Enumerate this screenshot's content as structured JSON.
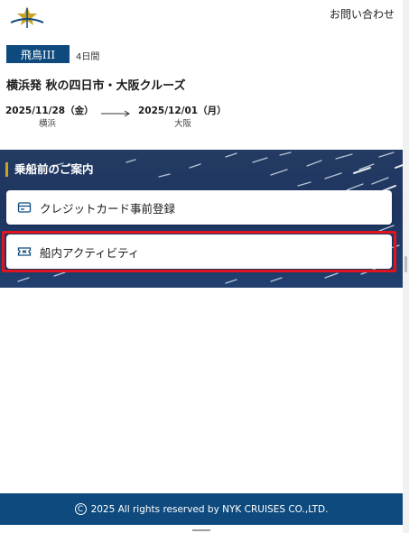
{
  "header": {
    "logo_icon": "anchor-star-logo",
    "contact_label": "お問い合わせ"
  },
  "cruise": {
    "ship_name": "飛鳥III",
    "duration": "4日間",
    "title": "横浜発 秋の四日市・大阪クルーズ",
    "departure": {
      "date": "2025/11/28（金）",
      "port": "横浜"
    },
    "arrival": {
      "date": "2025/12/01（月）",
      "port": "大阪"
    }
  },
  "boarding_section": {
    "heading": "乗船前のご案内",
    "items": [
      {
        "label": "クレジットカード事前登録",
        "icon": "credit-card-icon"
      },
      {
        "label": "船内アクティビティ",
        "icon": "ticket-icon",
        "highlighted": true
      }
    ]
  },
  "footer": {
    "copyright_symbol": "C",
    "text": "2025 All rights reserved by NYK CRUISES CO.,LTD."
  },
  "colors": {
    "brand_navy": "#0e4a7e",
    "ocean": "#1d3560",
    "accent_gold": "#c9a227",
    "highlight_red": "#e0141d"
  }
}
